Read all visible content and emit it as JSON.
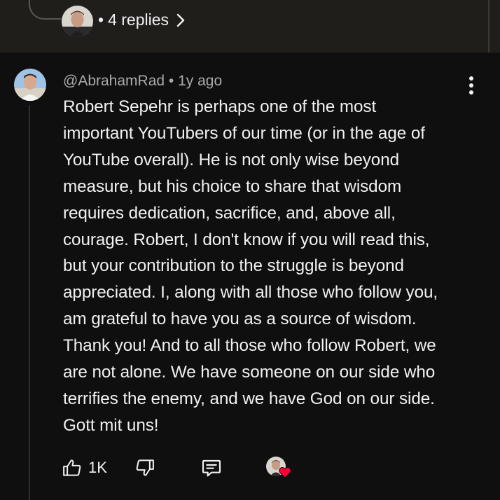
{
  "replies": {
    "separator": "•",
    "label": "4 replies"
  },
  "comment": {
    "author": "@AbrahamRad",
    "separator": "•",
    "time": "1y ago",
    "lines": [
      "Robert Sepehr is perhaps one of the most",
      "important YouTubers of our time (or in the age of",
      "YouTube overall). He is not only wise beyond",
      "measure, but his choice to share that wisdom",
      "requires dedication, sacrifice, and, above all,",
      "courage. Robert, I don't know if you will read this,",
      "but your contribution to the struggle is beyond",
      "appreciated. I, along with all those who follow you,",
      "am grateful to have you as a source of wisdom.",
      "Thank you! And to all those who follow Robert, we",
      "are not alone. We have someone on our side who",
      "terrifies the enemy, and we have God on our side.",
      "Gott mit uns!"
    ],
    "like_count": "1K"
  },
  "icons": {
    "more": "more-vert-icon",
    "like": "thumbs-up-icon",
    "dislike": "thumbs-down-icon",
    "reply": "reply-comment-icon",
    "heart": "creator-heart-icon",
    "chevron": "chevron-right-icon"
  },
  "colors": {
    "background": "#0f0f0f",
    "top_band": "#201e1a",
    "text": "#f1f1f1",
    "meta": "#aaaaaa",
    "heart": "#ff0033"
  }
}
